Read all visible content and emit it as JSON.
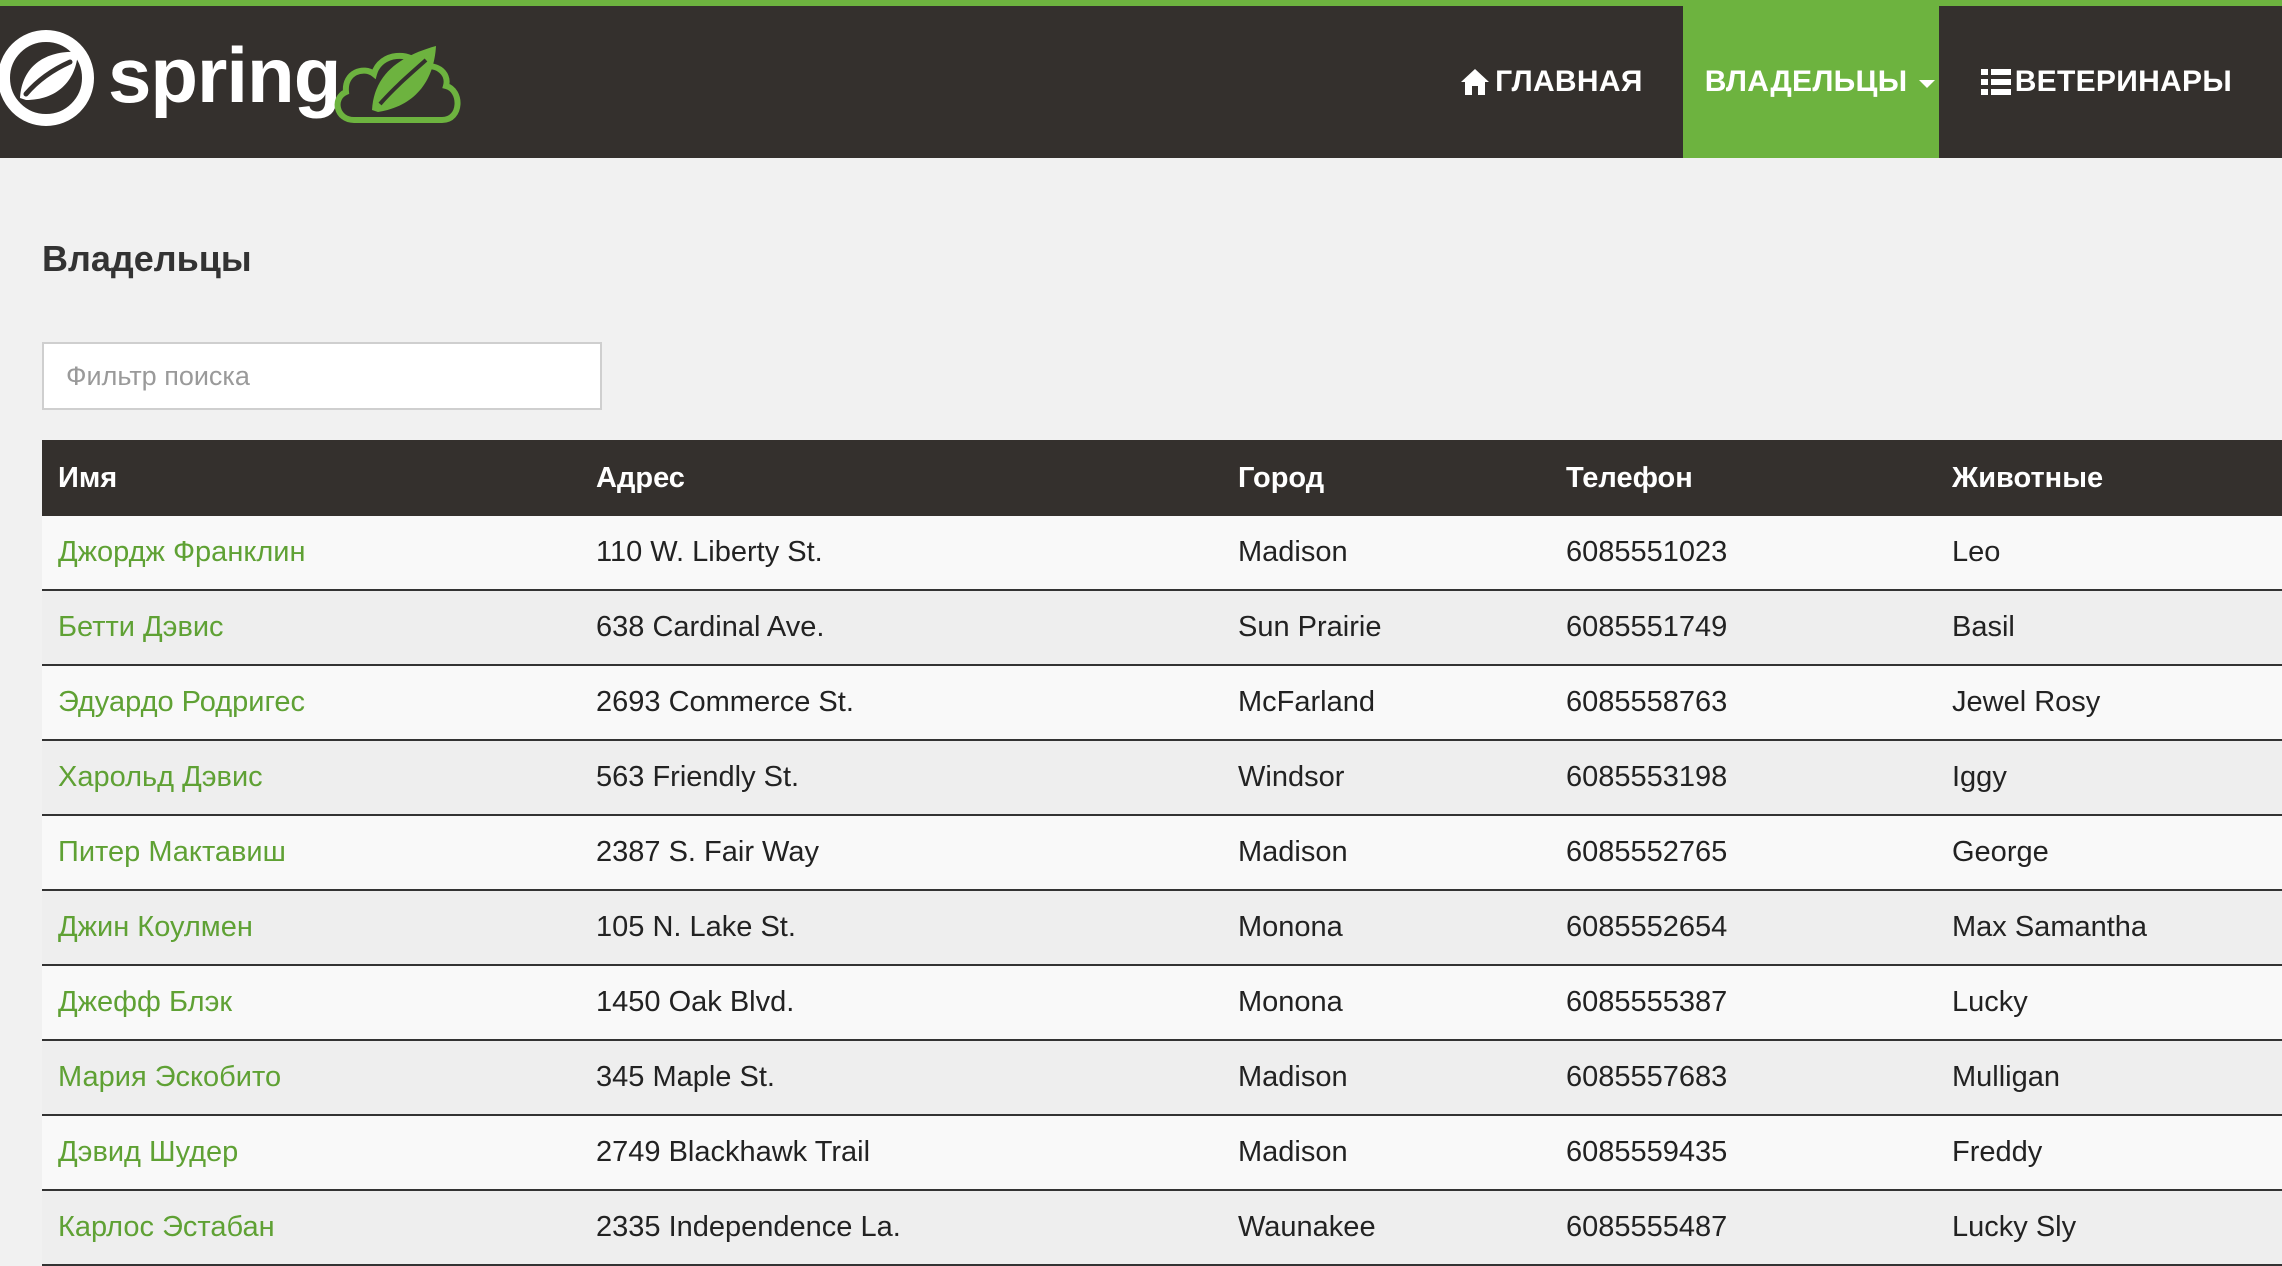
{
  "colors": {
    "brand_green": "#6db33f",
    "nav_dark": "#34302d",
    "link_green": "#5fa134",
    "page_bg": "#f1f1f1"
  },
  "brand": {
    "name": "spring"
  },
  "nav": {
    "items": [
      {
        "label": "ГЛАВНАЯ",
        "icon": "home-icon",
        "active": false
      },
      {
        "label": "ВЛАДЕЛЬЦЫ",
        "icon": "chevron-down-icon",
        "active": true
      },
      {
        "label": "ВЕТЕРИНАРЫ",
        "icon": "list-icon",
        "active": false
      }
    ]
  },
  "page": {
    "title": "Владельцы"
  },
  "search": {
    "value": "",
    "placeholder": "Фильтр поиска"
  },
  "table": {
    "columns": [
      "Имя",
      "Адрес",
      "Город",
      "Телефон",
      "Животные"
    ],
    "rows": [
      {
        "name": "Джордж Франклин",
        "address": "110 W. Liberty St.",
        "city": "Madison",
        "phone": "6085551023",
        "pets": "Leo"
      },
      {
        "name": "Бетти Дэвис",
        "address": "638 Cardinal Ave.",
        "city": "Sun Prairie",
        "phone": "6085551749",
        "pets": "Basil"
      },
      {
        "name": "Эдуардо Родригес",
        "address": "2693 Commerce St.",
        "city": "McFarland",
        "phone": "6085558763",
        "pets": "Jewel Rosy"
      },
      {
        "name": "Харольд Дэвис",
        "address": "563 Friendly St.",
        "city": "Windsor",
        "phone": "6085553198",
        "pets": "Iggy"
      },
      {
        "name": "Питер Мактавиш",
        "address": "2387 S. Fair Way",
        "city": "Madison",
        "phone": "6085552765",
        "pets": "George"
      },
      {
        "name": "Джин Коулмен",
        "address": "105 N. Lake St.",
        "city": "Monona",
        "phone": "6085552654",
        "pets": "Max Samantha"
      },
      {
        "name": "Джефф Блэк",
        "address": "1450 Oak Blvd.",
        "city": "Monona",
        "phone": "6085555387",
        "pets": "Lucky"
      },
      {
        "name": "Мария Эскобито",
        "address": "345 Maple St.",
        "city": "Madison",
        "phone": "6085557683",
        "pets": "Mulligan"
      },
      {
        "name": "Дэвид Шудер",
        "address": "2749 Blackhawk Trail",
        "city": "Madison",
        "phone": "6085559435",
        "pets": "Freddy"
      },
      {
        "name": "Карлос Эстабан",
        "address": "2335 Independence La.",
        "city": "Waunakee",
        "phone": "6085555487",
        "pets": "Lucky Sly"
      }
    ]
  }
}
